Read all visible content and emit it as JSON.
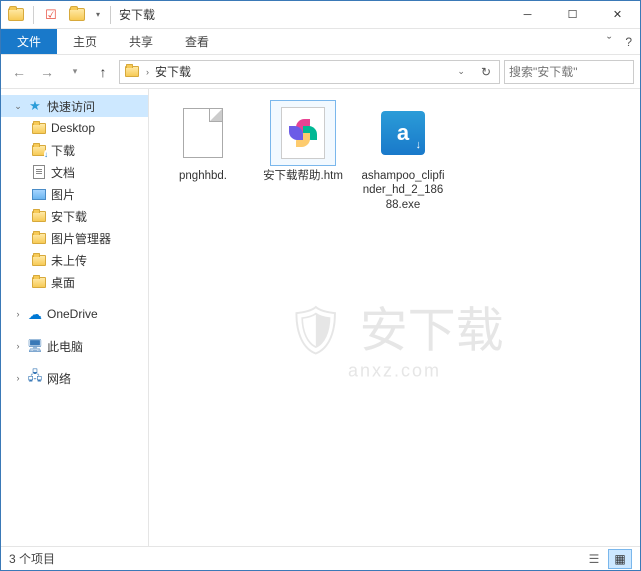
{
  "window": {
    "title": "安下载"
  },
  "ribbon": {
    "tabs": [
      "文件",
      "主页",
      "共享",
      "查看"
    ],
    "help": "?"
  },
  "nav": {
    "crumb": "安下载",
    "search_placeholder": "搜索\"安下载\""
  },
  "sidebar": {
    "quick_access": "快速访问",
    "items": [
      {
        "label": "Desktop"
      },
      {
        "label": "下载"
      },
      {
        "label": "文档"
      },
      {
        "label": "图片"
      },
      {
        "label": "安下载"
      },
      {
        "label": "图片管理器"
      },
      {
        "label": "未上传"
      },
      {
        "label": "桌面"
      }
    ],
    "onedrive": "OneDrive",
    "thispc": "此电脑",
    "network": "网络"
  },
  "files": [
    {
      "name": "pnghhbd."
    },
    {
      "name": "安下载帮助.htm"
    },
    {
      "name": "ashampoo_clipfinder_hd_2_18688.exe"
    }
  ],
  "watermark": {
    "text": "安下载",
    "url": "anxz.com"
  },
  "status": {
    "count": "3 个项目"
  }
}
